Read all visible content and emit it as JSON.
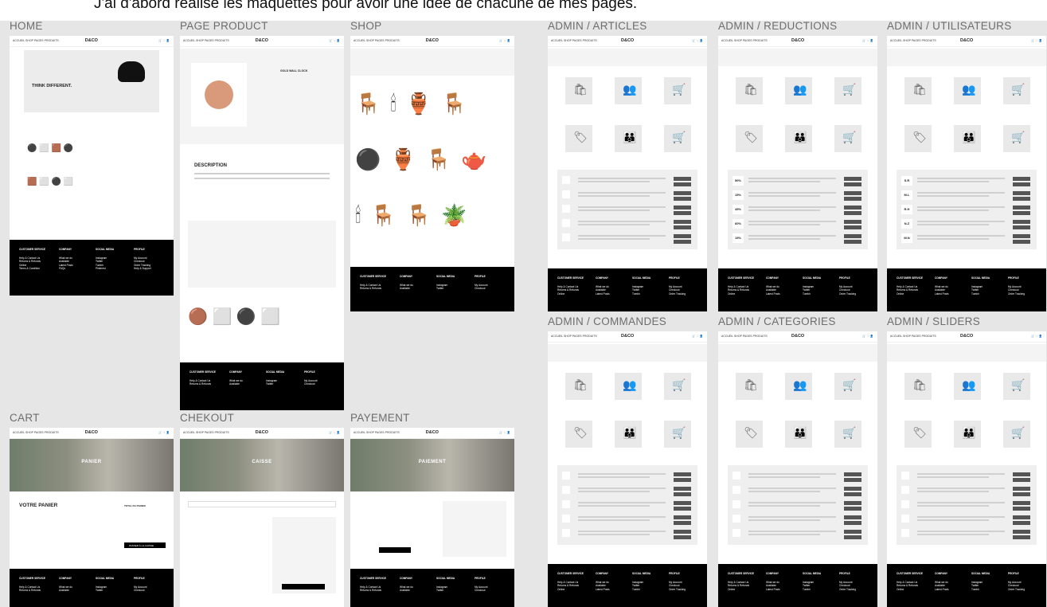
{
  "heading": "J'ai d'abord réalisé les maquettes pour avoir une idée de chacune de mes pages.",
  "brand": "D&CO",
  "nav_links": "ACCUEIL  SHOP  PAGES  PRODUITS",
  "nav_icons": "🛒 ♡ 👤",
  "footer": {
    "cols": [
      {
        "title": "CUSTOMER SERVICE",
        "items": [
          "Help & Contact Us",
          "Returns & Refunds",
          "Online",
          "Terms & Condition"
        ]
      },
      {
        "title": "COMPANY",
        "items": [
          "What we do",
          "Available",
          "Latest Posts",
          "FAQs"
        ]
      },
      {
        "title": "SOCIAL MEDIA",
        "items": [
          "Instagram",
          "Twitter",
          "Tumblr",
          "Pinterest"
        ]
      },
      {
        "title": "PROFILE",
        "items": [
          "My Account",
          "Checkout",
          "Order Tracking",
          "Help & Support"
        ]
      }
    ]
  },
  "pages": {
    "home": {
      "label": "HOME",
      "hero_title": "THINK DIFFERENT."
    },
    "product": {
      "label": "PAGE PRODUCT",
      "product_name": "GOLD WALL CLOCK",
      "description": "DESCRIPTION"
    },
    "shop": {
      "label": "SHOP"
    },
    "cart": {
      "label": "CART",
      "hero": "PANIER",
      "title": "VOTRE PANIER",
      "total_title": "TOTAL DU PANIER",
      "checkout_btn": "PASSER À LA CAISSE"
    },
    "checkout": {
      "label": "CHEKOUT",
      "hero": "CAISSE"
    },
    "payment": {
      "label": "PAYEMENT",
      "hero": "PAIEMENT"
    },
    "admin_articles": {
      "label": "ADMIN / ARTICLES"
    },
    "admin_reductions": {
      "label": "ADMIN / REDUCTIONS"
    },
    "admin_users": {
      "label": "ADMIN / UTILISATEURS"
    },
    "admin_orders": {
      "label": "ADMIN / COMMANDES"
    },
    "admin_categories": {
      "label": "ADMIN / CATEGORIES"
    },
    "admin_sliders": {
      "label": "ADMIN / SLIDERS"
    }
  },
  "reductions": [
    "50%",
    "15%",
    "45%",
    "60%",
    "15%"
  ],
  "user_initials": [
    "S.R",
    "M.L",
    "R.H",
    "N.Z",
    "M.N"
  ]
}
